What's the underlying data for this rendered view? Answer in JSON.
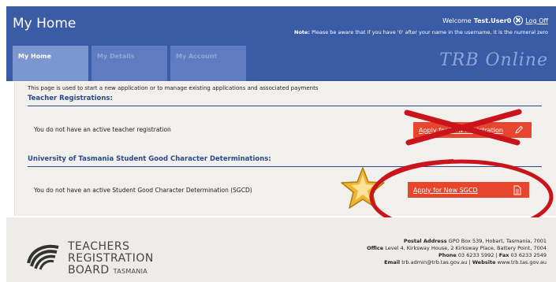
{
  "header": {
    "title": "My Home",
    "welcome_prefix": "Welcome",
    "username": "Test.User0",
    "logoff_label": "Log Off",
    "note_label": "Note:",
    "note_text": "Please be aware that if you have '0' after your name in the username, it is the numeral zero",
    "brand": "TRB Online",
    "tabs": [
      {
        "label": "My Home"
      },
      {
        "label": "My Details"
      },
      {
        "label": "My Account"
      }
    ]
  },
  "main": {
    "intro": "This page is used to start a new application or to manage existing applications and associated payments",
    "teacher": {
      "title": "Teacher Registrations:",
      "status": "You do not have an active teacher registration",
      "button": "Apply for New Registration"
    },
    "sgcd": {
      "title": "University of Tasmania Student Good Character Determinations:",
      "status": "You do not have an active Student Good Character Determination (SGCD)",
      "button": "Apply for New SGCD"
    }
  },
  "footer": {
    "logo": {
      "line1": "TEACHERS",
      "line2": "REGISTRATION",
      "line3a": "BOARD",
      "line3b": "TASMANIA"
    },
    "postal_label": "Postal Address",
    "postal": "GPO Box 539, Hobart, Tasmania, 7001",
    "office_label": "Office",
    "office": "Level 4, Kirksway House, 2 Kirksway Place, Battery Point, 7004",
    "phone_label": "Phone",
    "phone": "03 6233 5992",
    "fax_label": "Fax",
    "fax": "03 6233 2549",
    "email_label": "Email",
    "email": "trb.admin@trb.tas.gov.au",
    "website_label": "Website",
    "website": "www.trb.tas.gov.au"
  },
  "colors": {
    "header_bg": "#3a5ba5",
    "button_red": "#e8452f",
    "annotation_red": "#c8141a",
    "star_gold": "#f2b531"
  }
}
